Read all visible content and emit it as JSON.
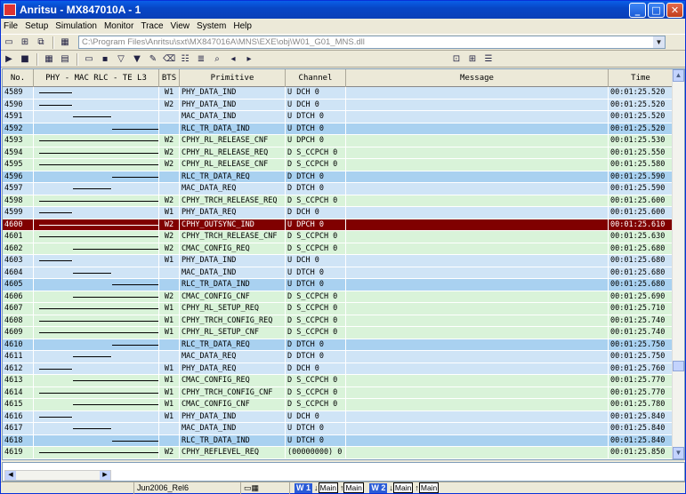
{
  "window": {
    "title": "Anritsu - MX847010A - 1"
  },
  "menu": [
    "File",
    "Setup",
    "Simulation",
    "Monitor",
    "Trace",
    "View",
    "System",
    "Help"
  ],
  "toolbar": {
    "path": "C:\\Program Files\\Anritsu\\sxt\\MX847016A\\MNS\\EXE\\obj\\W01_G01_MNS.dll"
  },
  "columns": {
    "no": "No.",
    "lanes": "PHY  -  MAC RLC  -  TE  L3",
    "bts": "BTS",
    "primitive": "Primitive",
    "channel": "Channel",
    "message": "Message",
    "time": "Time"
  },
  "rows": [
    {
      "no": "4589",
      "from": 0,
      "to": 1,
      "dir": "r",
      "bts": "W1",
      "prim": "PHY_DATA_IND",
      "chan": "U DCH 0",
      "time": "00:01:25.520",
      "cls": "c-blue"
    },
    {
      "no": "4590",
      "from": 0,
      "to": 1,
      "dir": "r",
      "bts": "W2",
      "prim": "PHY_DATA_IND",
      "chan": "U DCH 0",
      "time": "00:01:25.520",
      "cls": "c-blue"
    },
    {
      "no": "4591",
      "from": 1,
      "to": 2,
      "dir": "r",
      "bts": "",
      "prim": "MAC_DATA_IND",
      "chan": "U DTCH 0",
      "time": "00:01:25.520",
      "cls": "c-blue"
    },
    {
      "no": "4592",
      "from": 2,
      "to": 3,
      "dir": "r",
      "bts": "",
      "prim": "RLC_TR_DATA_IND",
      "chan": "U DTCH 0",
      "time": "00:01:25.520",
      "cls": "c-blue2"
    },
    {
      "no": "4593",
      "from": 0,
      "to": 4,
      "dir": "r",
      "bts": "W2",
      "prim": "CPHY_RL_RELEASE_CNF",
      "chan": "U DPCH 0",
      "time": "00:01:25.530",
      "cls": "c-green"
    },
    {
      "no": "4594",
      "from": 0,
      "to": 4,
      "dir": "l",
      "bts": "W2",
      "prim": "CPHY_RL_RELEASE_REQ",
      "chan": "D S_CCPCH 0",
      "time": "00:01:25.550",
      "cls": "c-green"
    },
    {
      "no": "4595",
      "from": 0,
      "to": 4,
      "dir": "r",
      "bts": "W2",
      "prim": "CPHY_RL_RELEASE_CNF",
      "chan": "D S_CCPCH 0",
      "time": "00:01:25.580",
      "cls": "c-green"
    },
    {
      "no": "4596",
      "from": 2,
      "to": 3,
      "dir": "l",
      "bts": "",
      "prim": "RLC_TR_DATA_REQ",
      "chan": "D DTCH 0",
      "time": "00:01:25.590",
      "cls": "c-blue2"
    },
    {
      "no": "4597",
      "from": 1,
      "to": 2,
      "dir": "l",
      "bts": "",
      "prim": "MAC_DATA_REQ",
      "chan": "D DTCH 0",
      "time": "00:01:25.590",
      "cls": "c-blue"
    },
    {
      "no": "4598",
      "from": 0,
      "to": 4,
      "dir": "l",
      "bts": "W2",
      "prim": "CPHY_TRCH_RELEASE_REQ",
      "chan": "D S_CCPCH 0",
      "time": "00:01:25.600",
      "cls": "c-green"
    },
    {
      "no": "4599",
      "from": 0,
      "to": 1,
      "dir": "l",
      "bts": "W1",
      "prim": "PHY_DATA_REQ",
      "chan": "D DCH 0",
      "time": "00:01:25.600",
      "cls": "c-blue"
    },
    {
      "no": "4600",
      "from": 0,
      "to": 4,
      "dir": "r",
      "bts": "W2",
      "prim": "CPHY_OUTSYNC_IND",
      "chan": "U DPCH 0",
      "time": "00:01:25.610",
      "cls": "c-sel"
    },
    {
      "no": "4601",
      "from": 0,
      "to": 4,
      "dir": "r",
      "bts": "W2",
      "prim": "CPHY_TRCH_RELEASE_CNF",
      "chan": "D S_CCPCH 0",
      "time": "00:01:25.630",
      "cls": "c-green"
    },
    {
      "no": "4602",
      "from": 1,
      "to": 4,
      "dir": "l",
      "bts": "W2",
      "prim": "CMAC_CONFIG_REQ",
      "chan": "D S_CCPCH 0",
      "time": "00:01:25.680",
      "cls": "c-green"
    },
    {
      "no": "4603",
      "from": 0,
      "to": 1,
      "dir": "r",
      "bts": "W1",
      "prim": "PHY_DATA_IND",
      "chan": "U DCH 0",
      "time": "00:01:25.680",
      "cls": "c-blue"
    },
    {
      "no": "4604",
      "from": 1,
      "to": 2,
      "dir": "r",
      "bts": "",
      "prim": "MAC_DATA_IND",
      "chan": "U DTCH 0",
      "time": "00:01:25.680",
      "cls": "c-blue"
    },
    {
      "no": "4605",
      "from": 2,
      "to": 3,
      "dir": "r",
      "bts": "",
      "prim": "RLC_TR_DATA_IND",
      "chan": "U DTCH 0",
      "time": "00:01:25.680",
      "cls": "c-blue2"
    },
    {
      "no": "4606",
      "from": 1,
      "to": 4,
      "dir": "r",
      "bts": "W2",
      "prim": "CMAC_CONFIG_CNF",
      "chan": "D S_CCPCH 0",
      "time": "00:01:25.690",
      "cls": "c-green"
    },
    {
      "no": "4607",
      "from": 0,
      "to": 4,
      "dir": "l",
      "bts": "W1",
      "prim": "CPHY_RL_SETUP_REQ",
      "chan": "D S_CCPCH 0",
      "time": "00:01:25.710",
      "cls": "c-green"
    },
    {
      "no": "4608",
      "from": 0,
      "to": 4,
      "dir": "l",
      "bts": "W1",
      "prim": "CPHY_TRCH_CONFIG_REQ",
      "chan": "D S_CCPCH 0",
      "time": "00:01:25.740",
      "cls": "c-green"
    },
    {
      "no": "4609",
      "from": 0,
      "to": 4,
      "dir": "r",
      "bts": "W1",
      "prim": "CPHY_RL_SETUP_CNF",
      "chan": "D S_CCPCH 0",
      "time": "00:01:25.740",
      "cls": "c-green"
    },
    {
      "no": "4610",
      "from": 2,
      "to": 3,
      "dir": "l",
      "bts": "",
      "prim": "RLC_TR_DATA_REQ",
      "chan": "D DTCH 0",
      "time": "00:01:25.750",
      "cls": "c-blue2"
    },
    {
      "no": "4611",
      "from": 1,
      "to": 2,
      "dir": "l",
      "bts": "",
      "prim": "MAC_DATA_REQ",
      "chan": "D DTCH 0",
      "time": "00:01:25.750",
      "cls": "c-blue"
    },
    {
      "no": "4612",
      "from": 0,
      "to": 1,
      "dir": "l",
      "bts": "W1",
      "prim": "PHY_DATA_REQ",
      "chan": "D DCH 0",
      "time": "00:01:25.760",
      "cls": "c-blue"
    },
    {
      "no": "4613",
      "from": 1,
      "to": 4,
      "dir": "l",
      "bts": "W1",
      "prim": "CMAC_CONFIG_REQ",
      "chan": "D S_CCPCH 0",
      "time": "00:01:25.770",
      "cls": "c-green"
    },
    {
      "no": "4614",
      "from": 0,
      "to": 4,
      "dir": "r",
      "bts": "W1",
      "prim": "CPHY_TRCH_CONFIG_CNF",
      "chan": "D S_CCPCH 0",
      "time": "00:01:25.770",
      "cls": "c-green"
    },
    {
      "no": "4615",
      "from": 1,
      "to": 4,
      "dir": "r",
      "bts": "W1",
      "prim": "CMAC_CONFIG_CNF",
      "chan": "D S_CCPCH 0",
      "time": "00:01:25.780",
      "cls": "c-green"
    },
    {
      "no": "4616",
      "from": 0,
      "to": 1,
      "dir": "r",
      "bts": "W1",
      "prim": "PHY_DATA_IND",
      "chan": "U DCH 0",
      "time": "00:01:25.840",
      "cls": "c-blue"
    },
    {
      "no": "4617",
      "from": 1,
      "to": 2,
      "dir": "r",
      "bts": "",
      "prim": "MAC_DATA_IND",
      "chan": "U DTCH 0",
      "time": "00:01:25.840",
      "cls": "c-blue"
    },
    {
      "no": "4618",
      "from": 2,
      "to": 3,
      "dir": "r",
      "bts": "",
      "prim": "RLC_TR_DATA_IND",
      "chan": "U DTCH 0",
      "time": "00:01:25.840",
      "cls": "c-blue2"
    },
    {
      "no": "4619",
      "from": 0,
      "to": 4,
      "dir": "r",
      "bts": "W2",
      "prim": "CPHY_REFLEVEL_REQ",
      "chan": "(00000000) 0",
      "time": "00:01:25.850",
      "cls": "c-green"
    }
  ],
  "status": {
    "version": "Jun2006_Rel6",
    "w1": "W 1",
    "w2": "W 2",
    "main": "Main"
  }
}
